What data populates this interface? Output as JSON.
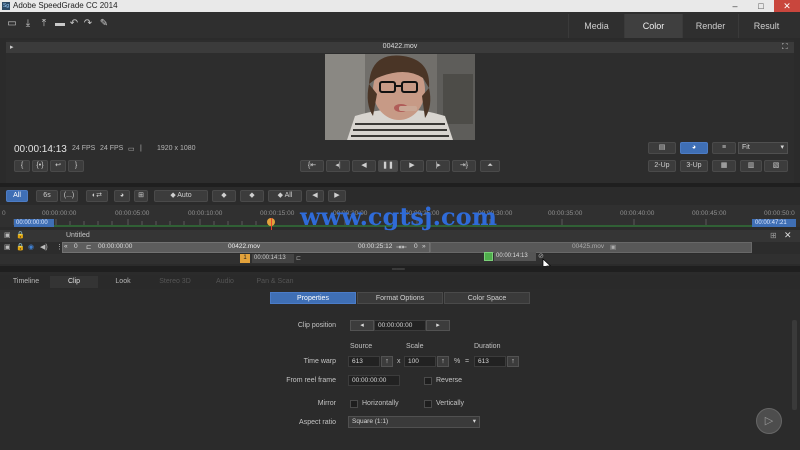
{
  "titlebar": {
    "app_icon": "Sg",
    "title": "Adobe SpeedGrade CC 2014",
    "minimize": "–",
    "maximize": "□",
    "close": "✕"
  },
  "main_tabs": [
    "Media",
    "Color",
    "Render",
    "Result"
  ],
  "active_main_tab": "Color",
  "viewer": {
    "filename": "00422.mov",
    "timecode": "00:00:14:13",
    "fps_1": "24 FPS",
    "fps_2": "24 FPS",
    "resolution": "1920 x 1080",
    "fit": "Fit",
    "compare_2up": "2-Up",
    "compare_3up": "3-Up"
  },
  "filter_bar": {
    "all": "All",
    "six": "6s",
    "dots": "(...)",
    "auto": "Auto",
    "all2": "All"
  },
  "timeline": {
    "ruler": [
      "00:00:00:00",
      "00:00:05:00",
      "00:00:10:00",
      "00:00:15:00",
      "00:00:20:00",
      "00:00:25:00",
      "00:00:30:00",
      "00:00:35:00",
      "00:00:40:00",
      "00:00:45:00",
      "00:00:50:0"
    ],
    "start_tc": "00:00:00:00",
    "end_tc": "00:00:47:21",
    "playhead_tc": "00:00:14:13",
    "track_name": "Untitled",
    "clip1": {
      "in_tc": "00:00:00:00",
      "name": "00422.mov",
      "out_tc": "00:00:25:12",
      "handle": "0",
      "head": "0"
    },
    "clip2": {
      "name": "00425.mov"
    },
    "current_marker": "1",
    "current_marker_tc": "00:00:14:13",
    "hover_tc": "00:00:14:13"
  },
  "bottom_tabs": [
    "Timeline",
    "Clip",
    "Look",
    "Stereo 3D",
    "Audio",
    "Pan & Scan"
  ],
  "active_bottom_tab": "Clip",
  "clip_subtabs": [
    "Properties",
    "Format Options",
    "Color Space"
  ],
  "active_clip_subtab": "Properties",
  "clip_properties": {
    "clip_position_label": "Clip position",
    "clip_position": "00:00:00:00",
    "source_header": "Source",
    "scale_header": "Scale",
    "duration_header": "Duration",
    "time_warp_label": "Time warp",
    "source": "613",
    "x": "x",
    "scale": "100",
    "percent": "%",
    "equals": "=",
    "duration": "613",
    "from_reel_label": "From reel frame",
    "from_reel": "00:00:00:00",
    "reverse_label": "Reverse",
    "mirror_label": "Mirror",
    "horizontally": "Horizontally",
    "vertically": "Vertically",
    "aspect_ratio_label": "Aspect ratio",
    "aspect_ratio": "Square (1:1)"
  },
  "watermark": "www.cgtsj.com",
  "colors": {
    "accent": "#3f6fb5",
    "playhead": "#e3432f",
    "clip_marker": "#e3a23b",
    "green": "#4fae4c"
  }
}
